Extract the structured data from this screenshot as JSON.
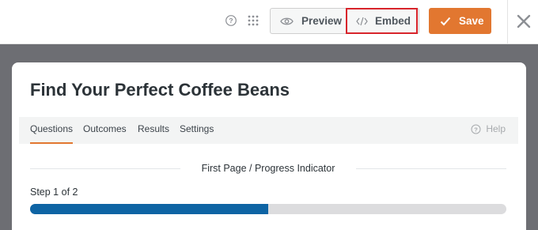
{
  "toolbar": {
    "help_icon": "help-circle-icon",
    "apps_icon": "grid-dots-icon",
    "preview_label": "Preview",
    "preview_icon": "eye-icon",
    "embed_label": "Embed",
    "embed_icon": "code-icon",
    "save_label": "Save",
    "save_icon": "checkmark-icon",
    "close_icon": "close-icon"
  },
  "colors": {
    "accent": "#e27730",
    "highlight": "#d8242b",
    "progress": "#0e64a4",
    "backdrop": "#6d6e73"
  },
  "form": {
    "title": "Find Your Perfect Coffee Beans",
    "tabs": [
      {
        "label": "Questions",
        "active": true
      },
      {
        "label": "Outcomes",
        "active": false
      },
      {
        "label": "Results",
        "active": false
      },
      {
        "label": "Settings",
        "active": false
      }
    ],
    "help_label": "Help",
    "section_title": "First Page / Progress Indicator",
    "step_text": "Step 1 of 2",
    "progress_fraction": 0.5
  }
}
